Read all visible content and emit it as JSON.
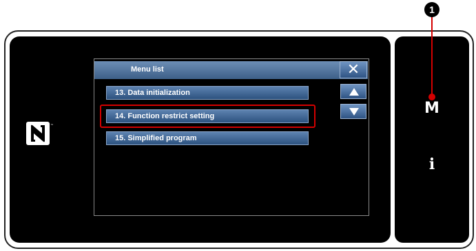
{
  "dialog": {
    "title": "Menu list",
    "close_label": "✕",
    "items": [
      {
        "label": "13.  Data initialization"
      },
      {
        "label": "14.  Function restrict setting"
      },
      {
        "label": "15.  Simplified program"
      }
    ]
  },
  "keys": {
    "menu_key": "M",
    "info_key": "i"
  },
  "callout": {
    "number": "1"
  },
  "colors": {
    "highlight": "#d40000",
    "button_top": "#6f94c2",
    "button_bottom": "#2f5484"
  }
}
